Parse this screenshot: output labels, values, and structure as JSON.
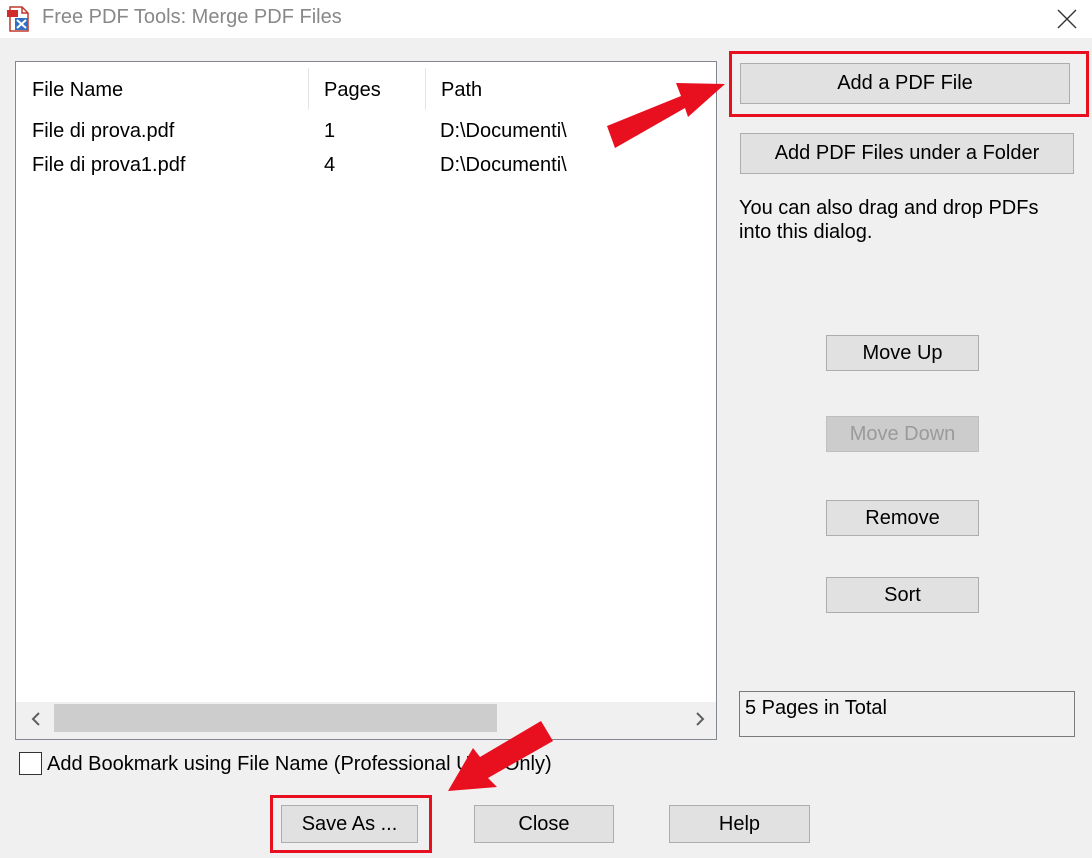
{
  "window": {
    "title": "Free PDF Tools: Merge PDF Files",
    "icon": "pdf-tools-icon",
    "close_icon": "close-icon"
  },
  "file_list": {
    "columns": [
      "File Name",
      "Pages",
      "Path"
    ],
    "rows": [
      {
        "name": "File di prova.pdf",
        "pages": "1",
        "path": "D:\\Documenti\\"
      },
      {
        "name": "File di prova1.pdf",
        "pages": "4",
        "path": "D:\\Documenti\\"
      }
    ],
    "scroll_left_icon": "chevron-left-icon",
    "scroll_right_icon": "chevron-right-icon"
  },
  "side_panel": {
    "add_file_label": "Add a PDF File",
    "add_folder_label": "Add PDF Files under a Folder",
    "hint": "You can also drag and drop PDFs into this dialog.",
    "move_up_label": "Move Up",
    "move_down_label": "Move Down",
    "remove_label": "Remove",
    "sort_label": "Sort",
    "total_text": "5 Pages in Total"
  },
  "bookmark_option": {
    "label": "Add Bookmark using File Name (Professional User Only)",
    "checked": false
  },
  "footer": {
    "save_as_label": "Save As ...",
    "close_label": "Close",
    "help_label": "Help"
  },
  "annotations": {
    "highlight_color": "#e8101f"
  }
}
